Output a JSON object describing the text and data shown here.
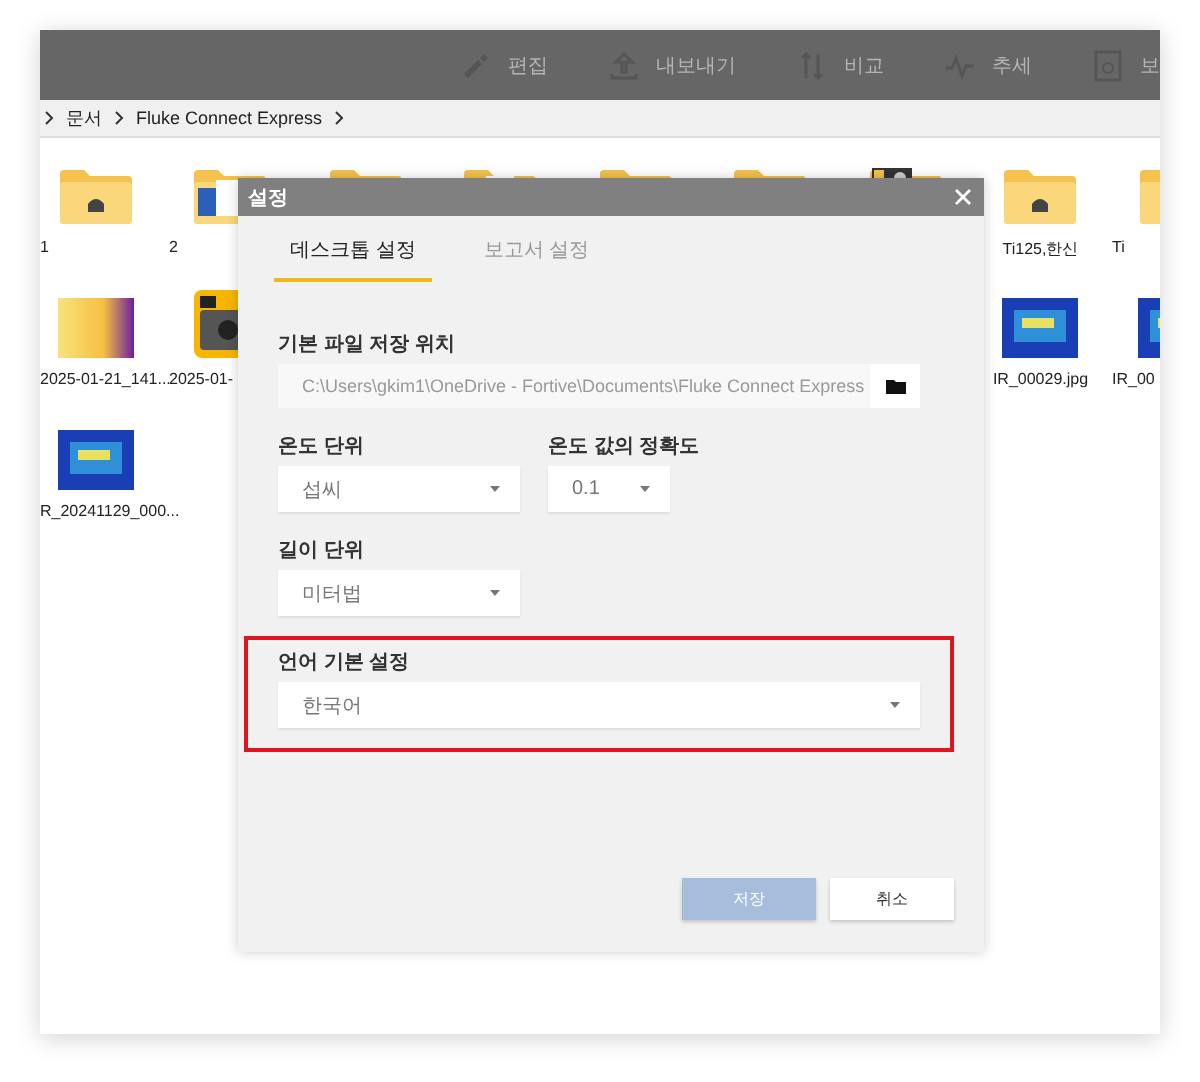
{
  "toolbar": {
    "items": [
      {
        "kind": "brush",
        "label": "편집"
      },
      {
        "kind": "upload",
        "label": "내보내기"
      },
      {
        "kind": "compare",
        "label": "비교"
      },
      {
        "kind": "trend",
        "label": "추세"
      },
      {
        "kind": "report",
        "label": "보"
      }
    ]
  },
  "breadcrumb": [
    "문서",
    "Fluke Connect Express"
  ],
  "files": [
    [
      {
        "kind": "folder",
        "label": "1"
      },
      {
        "kind": "folder-doc",
        "label": "2"
      },
      {
        "kind": "folder-doc"
      },
      {
        "kind": "folder-page"
      },
      {
        "kind": "folder"
      },
      {
        "kind": "folder"
      },
      {
        "kind": "folder-badge"
      },
      {
        "kind": "folder",
        "label": "Ti125,한신"
      },
      {
        "kind": "folder",
        "label": "Ti"
      }
    ],
    [
      {
        "kind": "thermal-warm",
        "label": "2025-01-21_141..."
      },
      {
        "kind": "camera-app",
        "label": "2025-01-"
      },
      {
        "kind": "covered"
      },
      {
        "kind": "covered"
      },
      {
        "kind": "covered"
      },
      {
        "kind": "covered"
      },
      {
        "kind": "covered"
      },
      {
        "kind": "thermal-cool",
        "label": "IR_00029.jpg"
      },
      {
        "kind": "thermal-cool",
        "label": "IR_00"
      }
    ],
    [
      {
        "kind": "thermal-cool",
        "label": "R_20241129_000..."
      }
    ]
  ],
  "dialog": {
    "title": "설정",
    "tabs": [
      {
        "label": "데스크톱 설정",
        "selected": true
      },
      {
        "label": "보고서 설정",
        "selected": false
      }
    ],
    "rows": [
      {
        "highlighted": false,
        "fields": [
          {
            "kind": "path",
            "label": "기본 파일 저장 위치",
            "value": "C:\\Users\\gkim1\\OneDrive - Fortive\\Documents\\Fluke Connect Express"
          }
        ]
      },
      {
        "highlighted": false,
        "fields": [
          {
            "kind": "select",
            "label": "온도 단위",
            "value": "섭씨"
          },
          {
            "kind": "select-narrow",
            "label": "온도 값의 정확도",
            "value": "0.1"
          }
        ]
      },
      {
        "highlighted": false,
        "fields": [
          {
            "kind": "select",
            "label": "길이 단위",
            "value": "미터법"
          }
        ]
      },
      {
        "highlighted": true,
        "fields": [
          {
            "kind": "select-wide",
            "label": "언어 기본 설정",
            "value": "한국어"
          }
        ]
      }
    ],
    "buttons": [
      {
        "label": "저장",
        "disabled": true
      },
      {
        "label": "취소",
        "disabled": false
      }
    ]
  }
}
